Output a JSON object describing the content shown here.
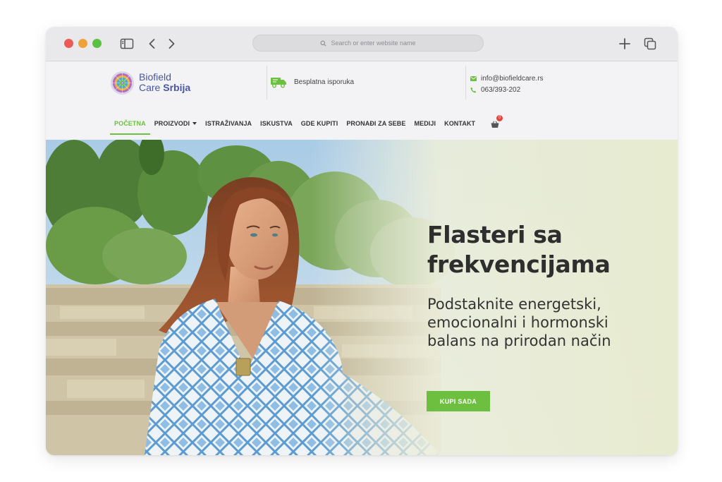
{
  "browser": {
    "address_placeholder": "Search or enter website name"
  },
  "header": {
    "logo_line1": "Biofield",
    "logo_line2a": "Care",
    "logo_line2b": "Srbija",
    "shipping_label": "Besplatna isporuka",
    "email": "info@biofieldcare.rs",
    "phone": "063/393-202"
  },
  "nav": {
    "items": [
      "POČETNA",
      "PROIZVODI",
      "ISTRAŽIVANJA",
      "ISKUSTVA",
      "GDE KUPITI",
      "PRONAĐI ZA SEBE",
      "MEDIJI",
      "KONTAKT"
    ],
    "cart_count": "0"
  },
  "hero": {
    "title": "Flasteri sa frekvencijama",
    "subtitle": "Podstaknite energetski, emocionalni i hormonski balans na prirodan način",
    "cta_label": "KUPI SADA"
  },
  "colors": {
    "accent": "#6cbf3f",
    "brand": "#4856a0",
    "badge": "#e0483f"
  }
}
